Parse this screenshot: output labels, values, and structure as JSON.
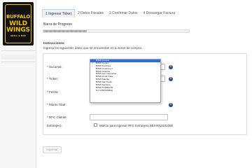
{
  "logo": {
    "line1": "BUFFALO",
    "line2a": "WILD",
    "line2b": "WINGS",
    "line3": "GRILL & BAR"
  },
  "tabs": [
    {
      "label": "1 Ingresar Ticket",
      "active": true
    },
    {
      "label": "2 Datos Fiscales",
      "active": false
    },
    {
      "label": "3 Confirmar Datos",
      "active": false
    },
    {
      "label": "4 Descargar Factura",
      "active": false
    }
  ],
  "progress": {
    "label": "Barra de Progreso",
    "percent": 30
  },
  "instructions": {
    "title": "Instrucciones:",
    "text": "Ingresa los siguientes datos que se encuentran en tu ticket de compra."
  },
  "form": {
    "sucursal_label": "* Sucursal :",
    "ticket_label": "* Ticket :",
    "fecha_label": "* Fecha :",
    "monto_label": "* Monto Total :",
    "rfc_label": "* RFC Cliente:",
    "extranjero_label": "Extranjero:",
    "extranjero_text": "Marcar para ingresar RFC Extranjero XEXX010101000"
  },
  "dropdown": {
    "selected": "BWW Centro",
    "highlighted": "BWW Acoxpa",
    "options": [
      "BWW Acoxpa",
      "BWW Centro",
      "BWW Cumbres",
      "BWW Cumbres 2",
      "BWW Galerias",
      "BWW Las Campanas",
      "BWW Linda Vista",
      "BWW Satelite",
      "BWW San Pedro",
      "BWW Sendero",
      "BWW TORREON",
      "NO DISPONIBLE"
    ]
  },
  "submit_label": "Ingresar",
  "icons": {
    "info": "info-icon",
    "check": "checkmark-icon"
  },
  "colors": {
    "highlight": "#2d6fd2",
    "info_icon": "#2f4a7a",
    "logo_yellow": "#f2c200"
  }
}
